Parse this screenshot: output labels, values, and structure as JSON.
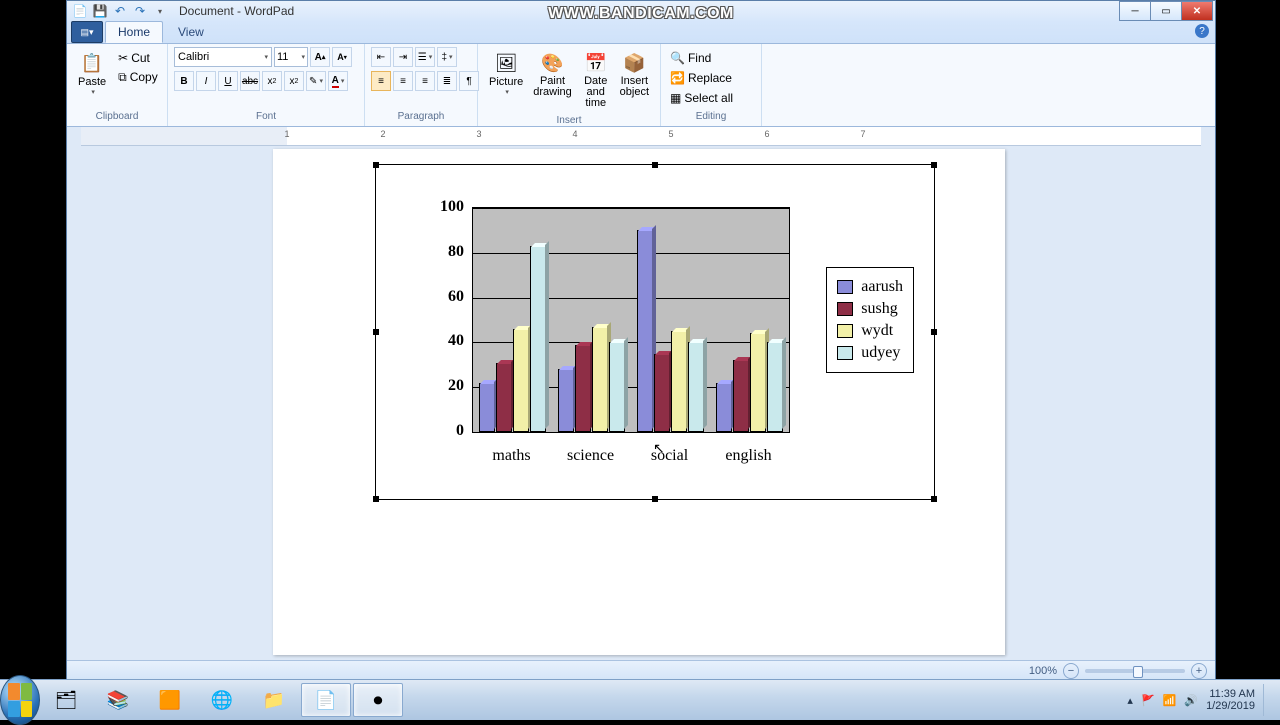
{
  "window": {
    "title": "Document - WordPad"
  },
  "watermark": "WWW.BANDICAM.COM",
  "appmenu": "▤▾",
  "tabs": {
    "home": "Home",
    "view": "View"
  },
  "clipboard": {
    "paste": "Paste",
    "cut": "Cut",
    "copy": "Copy",
    "group": "Clipboard"
  },
  "font": {
    "name": "Calibri",
    "size": "11",
    "group": "Font"
  },
  "paragraph": {
    "group": "Paragraph"
  },
  "insert": {
    "picture": "Picture",
    "paint": "Paint drawing",
    "datetime": "Date and time",
    "object": "Insert object",
    "group": "Insert"
  },
  "editing": {
    "find": "Find",
    "replace": "Replace",
    "selectall": "Select all",
    "group": "Editing"
  },
  "ruler_numbers": [
    "1",
    "2",
    "3",
    "4",
    "5",
    "6",
    "7"
  ],
  "chart_data": {
    "type": "bar",
    "categories": [
      "maths",
      "science",
      "social",
      "english"
    ],
    "series": [
      {
        "name": "aarush",
        "color": "#8A8CD9",
        "values": [
          22,
          28,
          90,
          22
        ]
      },
      {
        "name": "sushg",
        "color": "#8E2E46",
        "values": [
          31,
          39,
          35,
          32
        ]
      },
      {
        "name": "wydt",
        "color": "#F2F0A8",
        "values": [
          46,
          47,
          45,
          44
        ]
      },
      {
        "name": "udyey",
        "color": "#C9E9EC",
        "values": [
          83,
          40,
          40,
          40
        ]
      }
    ],
    "ylim": [
      0,
      100
    ],
    "yticks": [
      0,
      20,
      40,
      60,
      80,
      100
    ]
  },
  "status": {
    "zoom": "100%"
  },
  "systray": {
    "time": "11:39 AM",
    "date": "1/29/2019"
  }
}
